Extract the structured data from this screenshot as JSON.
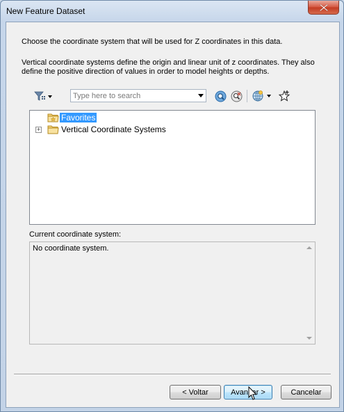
{
  "window": {
    "title": "New Feature Dataset",
    "close_icon": "close-icon"
  },
  "intro": {
    "line1": "Choose the coordinate system that will be used for Z coordinates in this data.",
    "line2": "Vertical coordinate systems define the origin and linear unit of z coordinates. They also",
    "line3": "define the positive direction of values in order to model heights or depths."
  },
  "toolbar": {
    "filter_icon": "filter-icon",
    "search_placeholder": "Type here to search",
    "search_value": "",
    "search_button_icon": "search-icon",
    "clear_search_icon": "clear-search-icon",
    "globe_icon": "globe-icon",
    "add_favorite_icon": "add-favorite-icon"
  },
  "tree": {
    "items": [
      {
        "label": "Favorites",
        "selected": true,
        "expandable": false
      },
      {
        "label": "Vertical Coordinate Systems",
        "selected": false,
        "expandable": true
      }
    ]
  },
  "current": {
    "label": "Current coordinate system:",
    "value": "No coordinate system."
  },
  "buttons": {
    "back": "< Voltar",
    "next": "Avançar >",
    "cancel": "Cancelar"
  },
  "colors": {
    "selection": "#3399ff",
    "close_button": "#c94a35",
    "frame": "#c6d6ea"
  }
}
